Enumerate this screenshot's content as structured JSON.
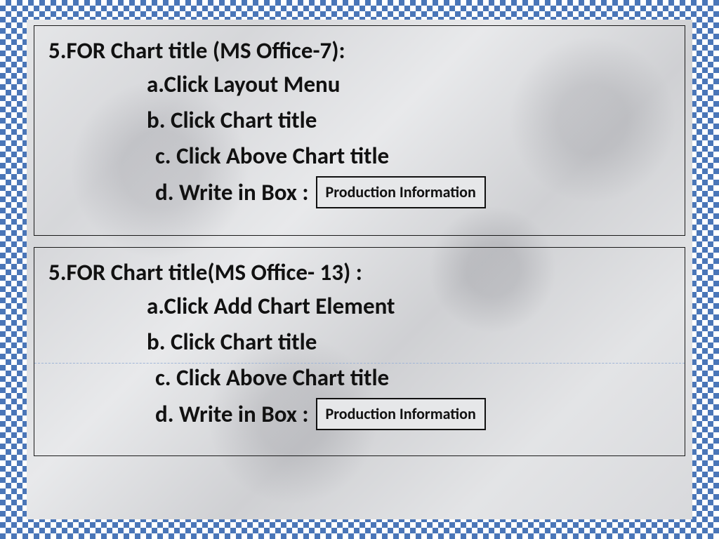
{
  "section1": {
    "heading": "5.FOR  Chart  title (MS Office-7):",
    "steps": {
      "a": "a.Click  Layout Menu",
      "b": "b. Click  Chart  title",
      "c": "c. Click Above Chart title",
      "d_prefix": "d. Write in Box :",
      "d_box": "Production  Information"
    }
  },
  "section2": {
    "heading": "5.FOR  Chart  title(MS Office- 13) :",
    "steps": {
      "a": "a.Click  Add Chart Element",
      "b": "b. Click  Chart  title",
      "c": "c. Click Above Chart title",
      "d_prefix": "d. Write in Box :",
      "d_box": "Production  Information"
    }
  }
}
